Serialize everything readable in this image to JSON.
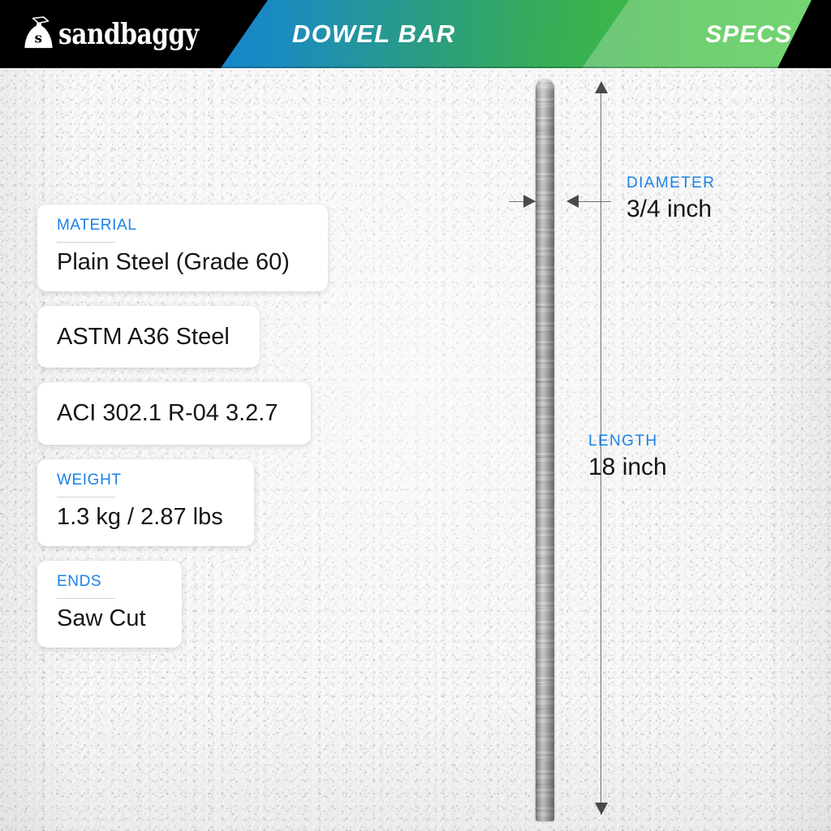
{
  "header": {
    "brand": "sandbaggy",
    "brand_icon": "sandbag-icon",
    "product_title": "DOWEL BAR",
    "section_title": "SPECS"
  },
  "specs": {
    "cards": [
      {
        "label": "MATERIAL",
        "value": "Plain Steel (Grade 60)"
      },
      {
        "label": "",
        "value": "ASTM A36 Steel"
      },
      {
        "label": "",
        "value": "ACI 302.1 R-04 3.2.7"
      },
      {
        "label": "WEIGHT",
        "value": "1.3 kg / 2.87 lbs"
      },
      {
        "label": "ENDS",
        "value": "Saw Cut"
      }
    ]
  },
  "dimensions": {
    "diameter": {
      "label": "DIAMETER",
      "value": "3/4 inch"
    },
    "length": {
      "label": "LENGTH",
      "value": "18 inch"
    }
  },
  "colors": {
    "accent_blue": "#1a82e8",
    "header_blue": "#0e7fd8",
    "header_green": "#45c83f",
    "text_dark": "#161616"
  }
}
